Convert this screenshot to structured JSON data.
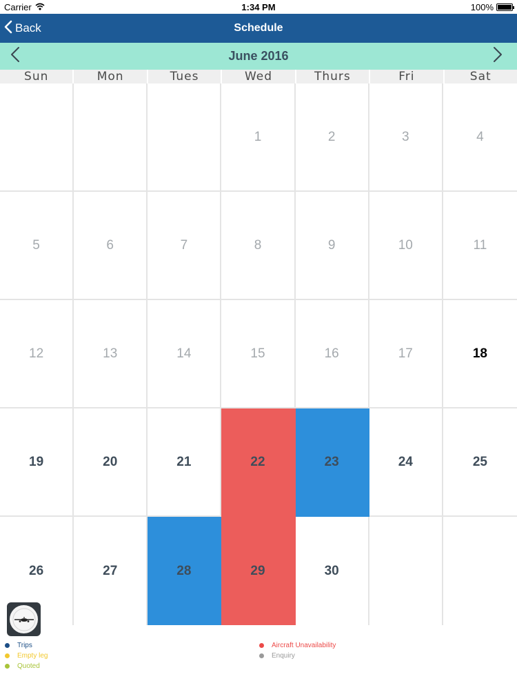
{
  "status_bar": {
    "carrier": "Carrier",
    "time": "1:34 PM",
    "battery": "100%"
  },
  "nav": {
    "back_label": "Back",
    "title": "Schedule"
  },
  "calendar": {
    "month_label": "June 2016",
    "weekdays": [
      "Sun",
      "Mon",
      "Tues",
      "Wed",
      "Thurs",
      "Fri",
      "Sat"
    ],
    "weeks": [
      [
        "",
        "",
        "",
        "1",
        "2",
        "3",
        "4"
      ],
      [
        "5",
        "6",
        "7",
        "8",
        "9",
        "10",
        "11"
      ],
      [
        "12",
        "13",
        "14",
        "15",
        "16",
        "17",
        "18"
      ],
      [
        "19",
        "20",
        "21",
        "22",
        "23",
        "24",
        "25"
      ],
      [
        "26",
        "27",
        "28",
        "29",
        "30",
        "",
        ""
      ]
    ]
  },
  "legend": {
    "trips": "Trips",
    "empty_leg": "Empty leg",
    "quoted": "Quoted",
    "aircraft_unavailability": "Aircraft Unavailability",
    "enquiry": "Enquiry"
  },
  "colors": {
    "nav_bar": "#1d5a96",
    "month_bar": "#9de7d4",
    "trips": "#1d4f86",
    "trip_fill": "#2d8fdb",
    "empty_leg": "#f2c92f",
    "quoted": "#a9c43a",
    "aircraft_unavailability": "#ec4a48",
    "enquiry": "#9a9a9a"
  }
}
